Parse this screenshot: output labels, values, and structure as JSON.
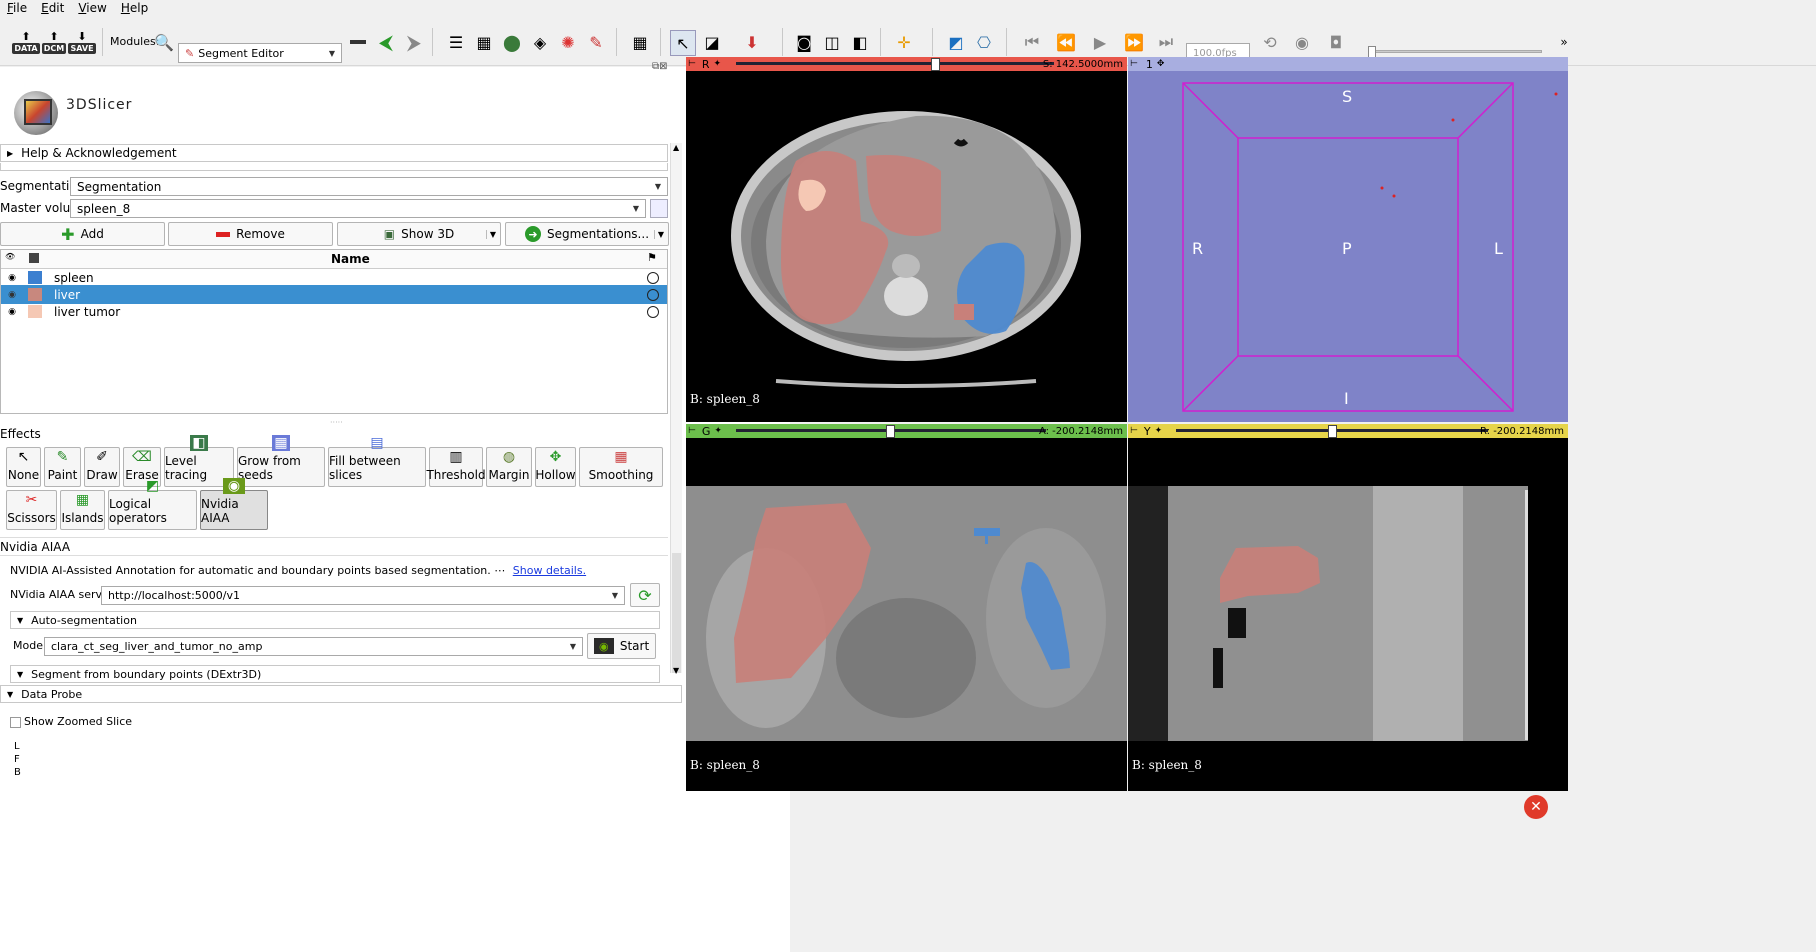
{
  "menu": [
    "File",
    "Edit",
    "View",
    "Help"
  ],
  "toolbar": {
    "data_label": "DATA",
    "dcm_label": "DCM",
    "save_label": "SAVE",
    "modules_label": "Modules:",
    "module_selected": "Segment Editor",
    "fps_value": "100.0fps"
  },
  "logo": {
    "text": "3DSlicer"
  },
  "help_section": "Help & Acknowledgement",
  "segmentation": {
    "label": "Segmentation:",
    "value": "Segmentation"
  },
  "master_volume": {
    "label": "Master volume:",
    "value": "spleen_8"
  },
  "buttons": {
    "add": "Add",
    "remove": "Remove",
    "show3d": "Show 3D",
    "segmentations": "Segmentations..."
  },
  "table": {
    "name_header": "Name",
    "rows": [
      {
        "name": "spleen",
        "color": "#3b7fd0"
      },
      {
        "name": "liver",
        "color": "#c8887e"
      },
      {
        "name": "liver tumor",
        "color": "#f5c8b4"
      }
    ]
  },
  "effects_title": "Effects",
  "effects": [
    "None",
    "Paint",
    "Draw",
    "Erase",
    "Level tracing",
    "Grow from seeds",
    "Fill between slices",
    "Threshold",
    "Margin",
    "Hollow",
    "Smoothing",
    "Scissors",
    "Islands",
    "Logical operators",
    "Nvidia AIAA"
  ],
  "nvidia": {
    "title": "Nvidia AIAA",
    "description": "NVIDIA AI-Assisted Annotation for automatic and boundary points based segmentation. ⋯",
    "show_details": "Show details.",
    "server_label": "NVidia AIAA server:",
    "server_value": "http://localhost:5000/v1",
    "auto_seg": "Auto-segmentation",
    "model_label": "Model:",
    "model_value": "clara_ct_seg_liver_and_tumor_no_amp",
    "start": "Start",
    "boundary": "Segment from boundary points (DExtr3D)"
  },
  "data_probe": {
    "title": "Data Probe",
    "zoom_label": "Show Zoomed Slice",
    "lines": [
      "L",
      "F",
      "B"
    ]
  },
  "views": {
    "red": {
      "letter": "R",
      "value": "S: 142.5000mm",
      "volume": "B: spleen_8",
      "color": "#e8564a"
    },
    "three_d": {
      "letter": "1",
      "labels": {
        "S": "S",
        "R": "R",
        "P": "P",
        "L": "L",
        "I": "I"
      }
    },
    "green": {
      "letter": "G",
      "value": "A: -200.2148mm",
      "volume": "B: spleen_8",
      "color": "#6cbf4c"
    },
    "yellow": {
      "letter": "Y",
      "value": "R: -200.2148mm",
      "volume": "B: spleen_8",
      "color": "#e6d44a"
    }
  },
  "colors": {
    "accent": "#3a8fd0",
    "spleen": "#3b7fd0",
    "liver": "#c8887e",
    "tumor": "#f5c8b4",
    "box3d": "#d020d0",
    "bg3d": "#7f83c8"
  }
}
